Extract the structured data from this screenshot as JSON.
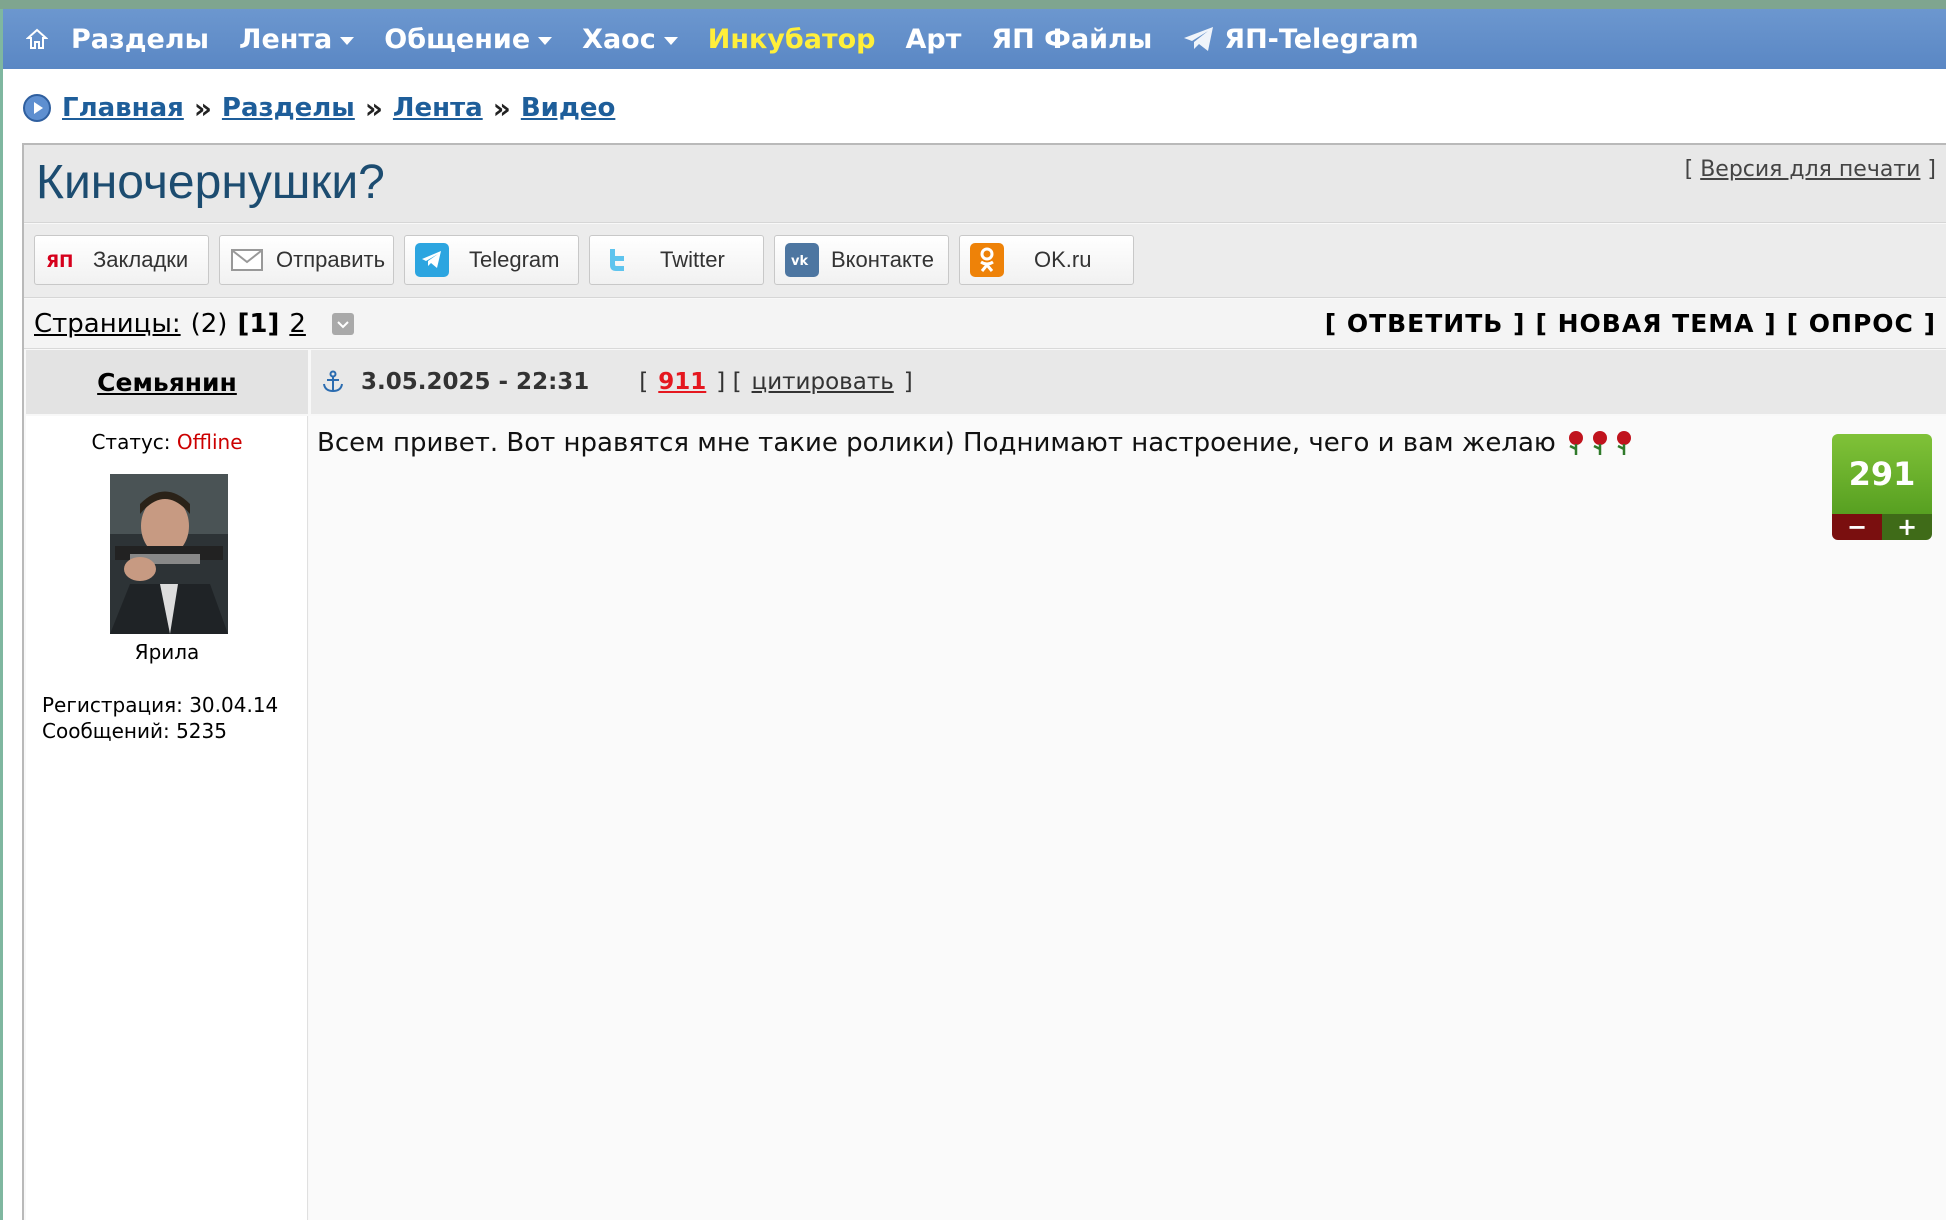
{
  "nav": {
    "items": [
      {
        "label": "Разделы",
        "dropdown": false
      },
      {
        "label": "Лента",
        "dropdown": true
      },
      {
        "label": "Общение",
        "dropdown": true
      },
      {
        "label": "Хаос",
        "dropdown": true
      },
      {
        "label": "Инкубатор",
        "dropdown": false,
        "highlight": "#ffef3a"
      },
      {
        "label": "Арт",
        "dropdown": false
      },
      {
        "label": "ЯП Файлы",
        "dropdown": false
      },
      {
        "label": "ЯП-Telegram",
        "dropdown": false
      }
    ],
    "colors": {
      "bar": "#6c97cf",
      "text": "#ffffff"
    }
  },
  "breadcrumb": {
    "items": [
      "Главная",
      "Разделы",
      "Лента",
      "Видео"
    ],
    "separator": "»"
  },
  "topic": {
    "title": "Киночернушки?",
    "print_version": "Версия для печати"
  },
  "share": {
    "buttons": [
      {
        "label": "Закладки",
        "icon": "yap-icon"
      },
      {
        "label": "Отправить",
        "icon": "mail-icon"
      },
      {
        "label": "Telegram",
        "icon": "telegram-icon"
      },
      {
        "label": "Twitter",
        "icon": "twitter-icon"
      },
      {
        "label": "Вконтакте",
        "icon": "vk-icon"
      },
      {
        "label": "OK.ru",
        "icon": "ok-icon"
      }
    ]
  },
  "pages": {
    "label": "Страницы:",
    "total": "(2)",
    "current": "[1]",
    "next": "2",
    "actions": [
      "[ ОТВЕТИТЬ ]",
      "[ НОВАЯ ТЕМА ]",
      "[ ОПРОС ]"
    ]
  },
  "post": {
    "author": "Семьянин",
    "status_label": "Статус:",
    "status_value": "Offline",
    "user_title": "Ярила",
    "registration": "Регистрация: 30.04.14",
    "messages": "Сообщений: 5235",
    "date": "3.05.2025 - 22:31",
    "number": "911",
    "quote": "цитировать",
    "text": "Всем привет. Вот нравятся мне такие ролики) Поднимают настроение, чего и вам желаю",
    "rating": "291",
    "rate_minus": "−",
    "rate_plus": "+"
  }
}
